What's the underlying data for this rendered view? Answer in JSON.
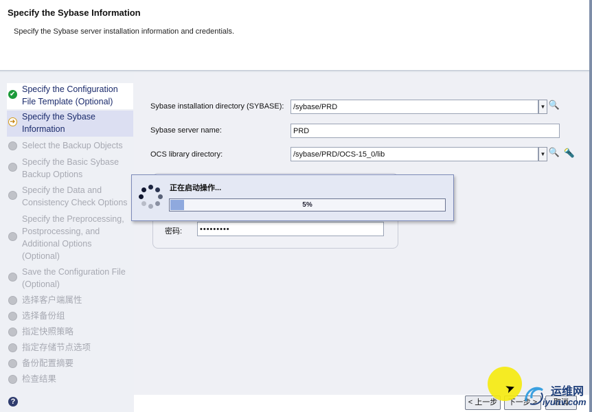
{
  "header": {
    "title": "Specify the Sybase Information",
    "subtitle": "Specify the Sybase server installation information and credentials."
  },
  "steps": [
    {
      "lines": [
        "Specify the Configuration",
        "File Template (Optional)"
      ],
      "state": "done"
    },
    {
      "lines": [
        "Specify the Sybase",
        "Information"
      ],
      "state": "active"
    },
    {
      "lines": [
        "Select the Backup Objects"
      ],
      "state": "pending"
    },
    {
      "lines": [
        "Specify the Basic Sybase",
        "Backup Options"
      ],
      "state": "pending"
    },
    {
      "lines": [
        "Specify the Data and",
        "Consistency Check Options"
      ],
      "state": "pending"
    },
    {
      "lines": [
        "Specify the Preprocessing,",
        "Postprocessing, and",
        "Additional Options",
        "(Optional)"
      ],
      "state": "pending"
    },
    {
      "lines": [
        "Save the Configuration File",
        "(Optional)"
      ],
      "state": "pending"
    },
    {
      "lines": [
        "选择客户端属性"
      ],
      "state": "pending"
    },
    {
      "lines": [
        "选择备份组"
      ],
      "state": "pending"
    },
    {
      "lines": [
        "指定快照策略"
      ],
      "state": "pending"
    },
    {
      "lines": [
        "指定存储节点选项"
      ],
      "state": "pending"
    },
    {
      "lines": [
        "备份配置摘要"
      ],
      "state": "pending"
    },
    {
      "lines": [
        "检查结果"
      ],
      "state": "pending"
    }
  ],
  "form": {
    "install_dir_label": "Sybase installation directory (SYBASE):",
    "install_dir_value": "/sybase/PRD",
    "server_name_label": "Sybase server name:",
    "server_name_value": "PRD",
    "ocs_label": "OCS library directory:",
    "ocs_value": "/sybase/PRD/OCS-15_0/lib",
    "password_label": "密码:",
    "password_value": "•••••••••"
  },
  "progress": {
    "title": "正在启动操作...",
    "percent": 5,
    "percent_text": "5%"
  },
  "buttons": {
    "back": "< 上一步",
    "next": "下一步 >",
    "cancel": "取消"
  },
  "help_glyph": "?",
  "watermark": {
    "line1": "运维网",
    "line2": "iyunv.com"
  },
  "icons": {
    "done": "check-icon",
    "active": "arrow-right-icon",
    "pending": "pending-dot-icon",
    "browse": "magnifier-icon",
    "flashlight": "flashlight-icon"
  }
}
